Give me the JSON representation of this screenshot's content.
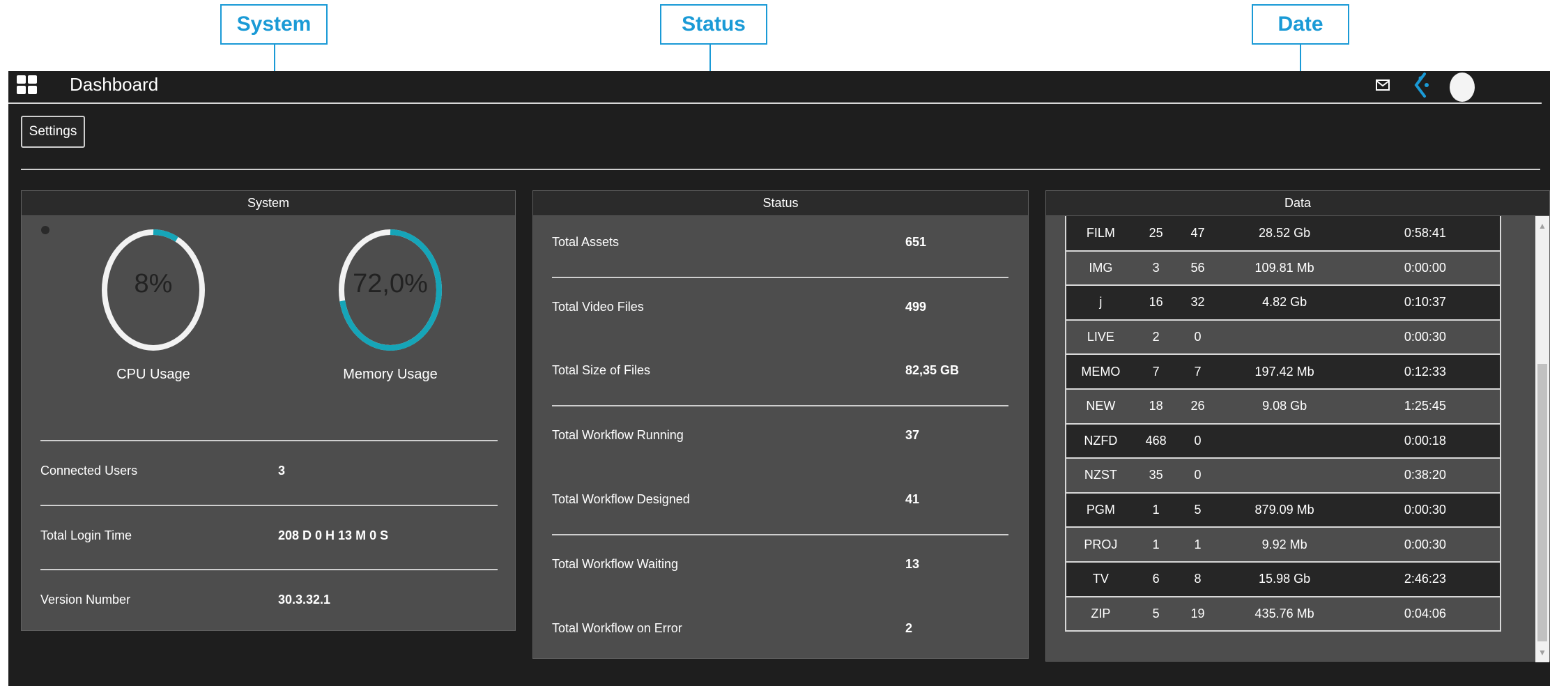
{
  "callouts": {
    "system": "System",
    "status": "Status",
    "date": "Date"
  },
  "topbar": {
    "title": "Dashboard"
  },
  "toolbar": {
    "settings_label": "Settings"
  },
  "system": {
    "header": "System",
    "cpu": {
      "value": "8%",
      "fraction": 0.08,
      "label": "CPU Usage"
    },
    "memory": {
      "value": "72,0%",
      "fraction": 0.72,
      "label": "Memory Usage"
    },
    "rows": [
      {
        "label": "Connected Users",
        "value": "3"
      },
      {
        "label": "Total Login Time",
        "value": "208 D 0 H 13 M 0 S"
      },
      {
        "label": "Version Number",
        "value": "30.3.32.1"
      }
    ]
  },
  "status": {
    "header": "Status",
    "rows": [
      {
        "label": "Total Assets",
        "value": "651"
      },
      {
        "label": "Total Video Files",
        "value": "499"
      },
      {
        "label": "Total Size of Files",
        "value": "82,35 GB"
      },
      {
        "label": "Total Workflow Running",
        "value": "37"
      },
      {
        "label": "Total Workflow Designed",
        "value": "41"
      },
      {
        "label": "Total Workflow Waiting",
        "value": "13"
      },
      {
        "label": "Total Workflow on Error",
        "value": "2"
      }
    ]
  },
  "data": {
    "header": "Data",
    "rows": [
      [
        "FILM",
        "25",
        "47",
        "28.52 Gb",
        "0:58:41"
      ],
      [
        "IMG",
        "3",
        "56",
        "109.81 Mb",
        "0:00:00"
      ],
      [
        "j",
        "16",
        "32",
        "4.82 Gb",
        "0:10:37"
      ],
      [
        "LIVE",
        "2",
        "0",
        "",
        "0:00:30"
      ],
      [
        "MEMO",
        "7",
        "7",
        "197.42 Mb",
        "0:12:33"
      ],
      [
        "NEW",
        "18",
        "26",
        "9.08 Gb",
        "1:25:45"
      ],
      [
        "NZFD",
        "468",
        "0",
        "",
        "0:00:18"
      ],
      [
        "NZST",
        "35",
        "0",
        "",
        "0:38:20"
      ],
      [
        "PGM",
        "1",
        "5",
        "879.09 Mb",
        "0:00:30"
      ],
      [
        "PROJ",
        "1",
        "1",
        "9.92 Mb",
        "0:00:30"
      ],
      [
        "TV",
        "6",
        "8",
        "15.98 Gb",
        "2:46:23"
      ],
      [
        "ZIP",
        "5",
        "19",
        "435.76 Mb",
        "0:04:06"
      ]
    ]
  },
  "colors": {
    "accent": "#1a9ad6",
    "gauge": "#16a5b8",
    "track": "#f2f2f2"
  },
  "icons": [
    "grid-icon",
    "mail-icon",
    "brand-icon",
    "avatar",
    "scroll-up-icon",
    "scroll-down-icon"
  ]
}
